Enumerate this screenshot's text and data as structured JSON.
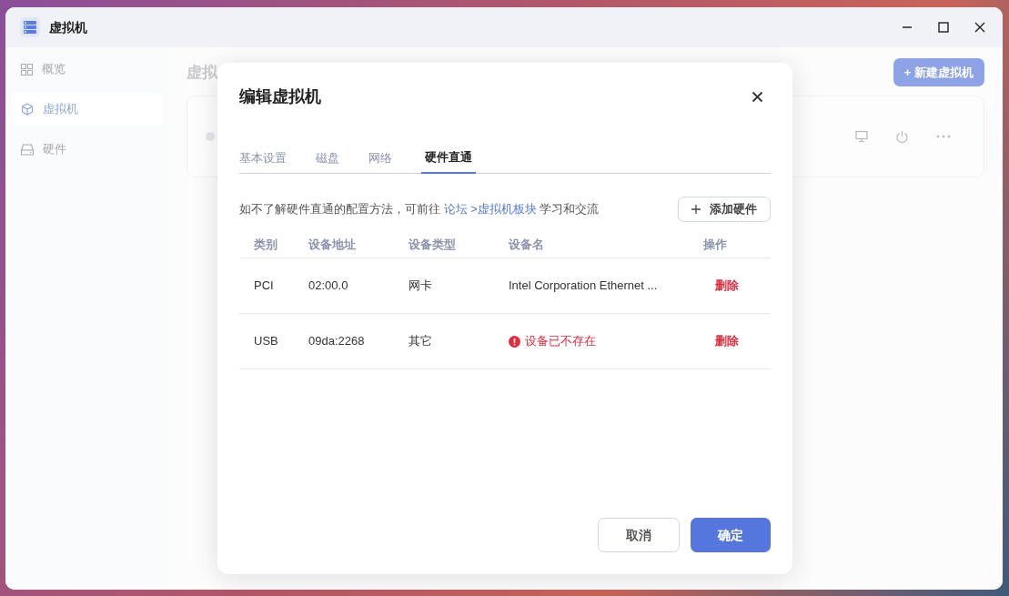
{
  "window": {
    "title": "虚拟机"
  },
  "sidebar": {
    "items": [
      {
        "label": "概览",
        "selected": false
      },
      {
        "label": "虚拟机",
        "selected": true
      },
      {
        "label": "硬件",
        "selected": false
      }
    ]
  },
  "page": {
    "title": "虚拟",
    "new_button": "+ 新建虚拟机"
  },
  "dialog": {
    "title": "编辑虚拟机",
    "tabs": [
      {
        "label": "基本设置",
        "selected": false
      },
      {
        "label": "磁盘",
        "selected": false
      },
      {
        "label": "网络",
        "selected": false
      },
      {
        "label": "硬件直通",
        "selected": true
      }
    ],
    "notice": {
      "before": "如不了解硬件直通的配置方法，可前往 ",
      "link": "论坛 >虚拟机板块",
      "after": " 学习和交流"
    },
    "add_button": "添加硬件",
    "table": {
      "columns": [
        "类别",
        "设备地址",
        "设备类型",
        "设备名",
        "操作"
      ],
      "rows": [
        {
          "category": "PCI",
          "address": "02:00.0",
          "type": "网卡",
          "name": "Intel Corporation Ethernet ...",
          "missing": false,
          "action": "删除"
        },
        {
          "category": "USB",
          "address": "09da:2268",
          "type": "其它",
          "name": "设备已不存在",
          "missing": true,
          "action": "删除"
        }
      ]
    },
    "buttons": {
      "cancel": "取消",
      "confirm": "确定"
    }
  }
}
